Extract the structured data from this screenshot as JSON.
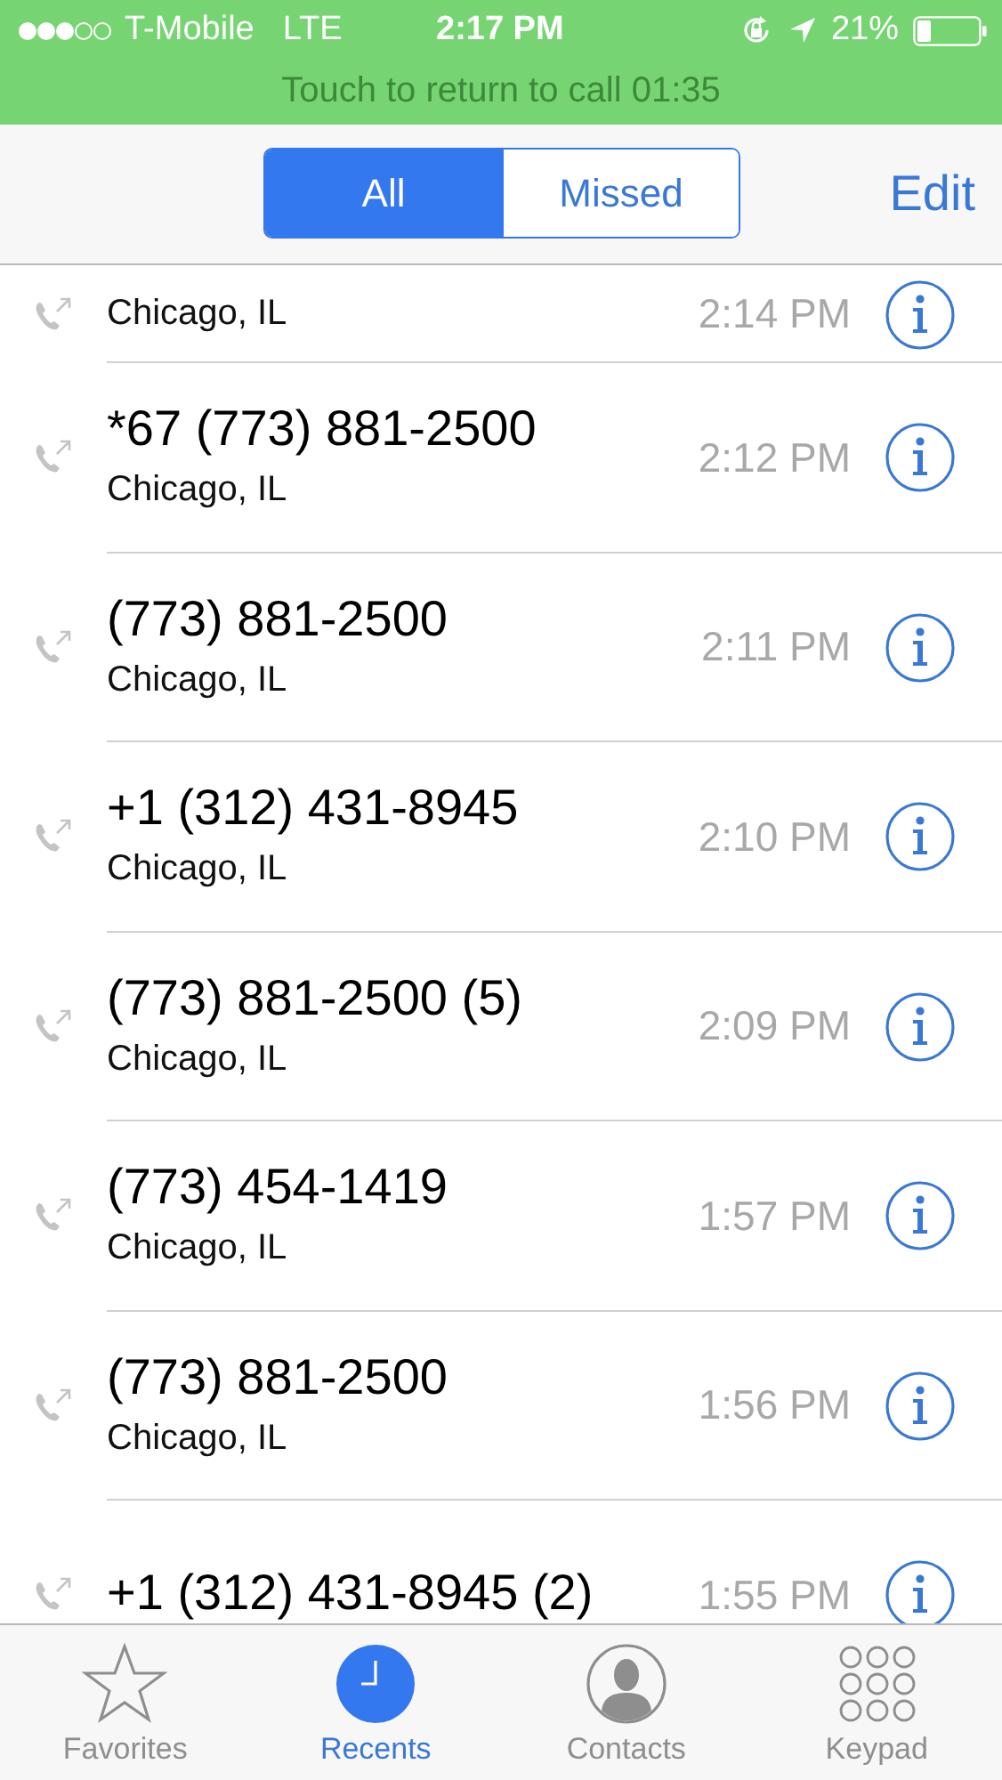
{
  "status_bar": {
    "carrier": "T-Mobile",
    "network": "LTE",
    "time": "2:17 PM",
    "battery": "21%"
  },
  "call_banner": "Touch to return to call 01:35",
  "segments": [
    {
      "label": "All",
      "selected": true
    },
    {
      "label": "Missed",
      "selected": false
    }
  ],
  "edit": "Edit",
  "calls": [
    {
      "location": "Chicago, IL",
      "time": "2:14 PM"
    },
    {
      "number": "*67 (773) 881-2500",
      "location": "Chicago, IL",
      "time": "2:12 PM"
    },
    {
      "number": "(773) 881-2500",
      "location": "Chicago, IL",
      "time": "2:11 PM"
    },
    {
      "number": "+1 (312) 431-8945",
      "location": "Chicago, IL",
      "time": "2:10 PM"
    },
    {
      "number": "(773) 881-2500 (5)",
      "location": "Chicago, IL",
      "time": "2:09 PM"
    },
    {
      "number": "(773) 454-1419",
      "location": "Chicago, IL",
      "time": "1:57 PM"
    },
    {
      "number": "(773) 881-2500",
      "location": "Chicago, IL",
      "time": "1:56 PM"
    },
    {
      "number": "+1 (312) 431-8945 (2)",
      "time": "1:55 PM"
    }
  ],
  "tabs": [
    {
      "kind": "star",
      "label": "Favorites",
      "selected": false
    },
    {
      "kind": "clock",
      "label": "Recents",
      "selected": true
    },
    {
      "kind": "person",
      "label": "Contacts",
      "selected": false
    },
    {
      "kind": "keypad",
      "label": "Keypad",
      "selected": false
    }
  ]
}
